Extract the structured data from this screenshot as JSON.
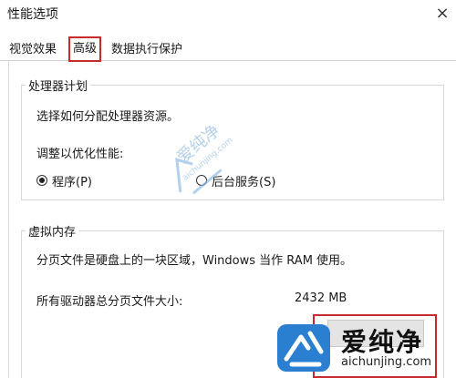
{
  "window": {
    "title": "性能选项",
    "close_glyph": "×"
  },
  "tabs": [
    {
      "label": "视觉效果",
      "selected": false
    },
    {
      "label": "高级",
      "selected": true
    },
    {
      "label": "数据执行保护",
      "selected": false
    }
  ],
  "processor_group": {
    "title": "处理器计划",
    "description": "选择如何分配处理器资源。",
    "adjust_label": "调整以优化性能:",
    "options": [
      {
        "label": "程序(P)",
        "checked": true
      },
      {
        "label": "后台服务(S)",
        "checked": false
      }
    ]
  },
  "virtual_memory_group": {
    "title": "虚拟内存",
    "description": "分页文件是硬盘上的一块区域，Windows 当作 RAM 使用。",
    "total_label": "所有驱动器总分页文件大小:",
    "total_value": "2432 MB"
  },
  "watermark": {
    "center_text": "爱纯净",
    "center_url": "aichunjing.com",
    "brand": "爱纯净",
    "url": "aichunjing.com"
  },
  "colors": {
    "highlight_red": "#c62a2a",
    "watermark_blue": "#2b7fd1"
  }
}
